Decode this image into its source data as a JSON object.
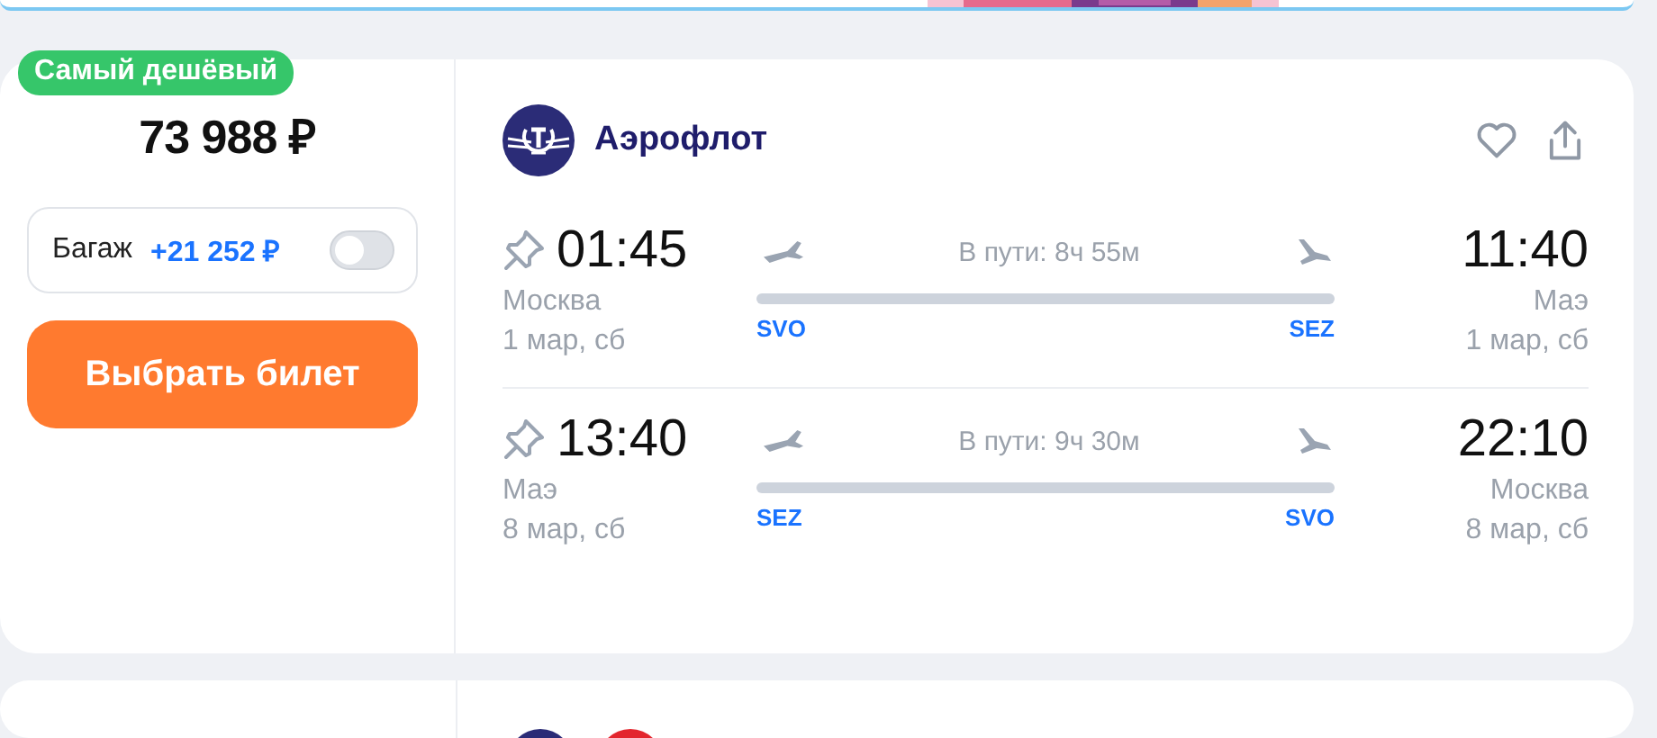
{
  "badge": "Самый дешёвый",
  "price": "73 988 ₽",
  "baggage": {
    "label": "Багаж",
    "price": "+21 252 ₽",
    "on": false
  },
  "select_button": "Выбрать билет",
  "airline": {
    "name": "Аэрофлот"
  },
  "segments": [
    {
      "depart_time": "01:45",
      "depart_city": "Москва",
      "depart_date": "1 мар, сб",
      "duration": "В пути: 8ч 55м",
      "from_code": "SVO",
      "to_code": "SEZ",
      "arrive_time": "11:40",
      "arrive_city": "Маэ",
      "arrive_date": "1 мар, сб"
    },
    {
      "depart_time": "13:40",
      "depart_city": "Маэ",
      "depart_date": "8 мар, сб",
      "duration": "В пути: 9ч 30м",
      "from_code": "SEZ",
      "to_code": "SVO",
      "arrive_time": "22:10",
      "arrive_city": "Москва",
      "arrive_date": "8 мар, сб"
    }
  ]
}
